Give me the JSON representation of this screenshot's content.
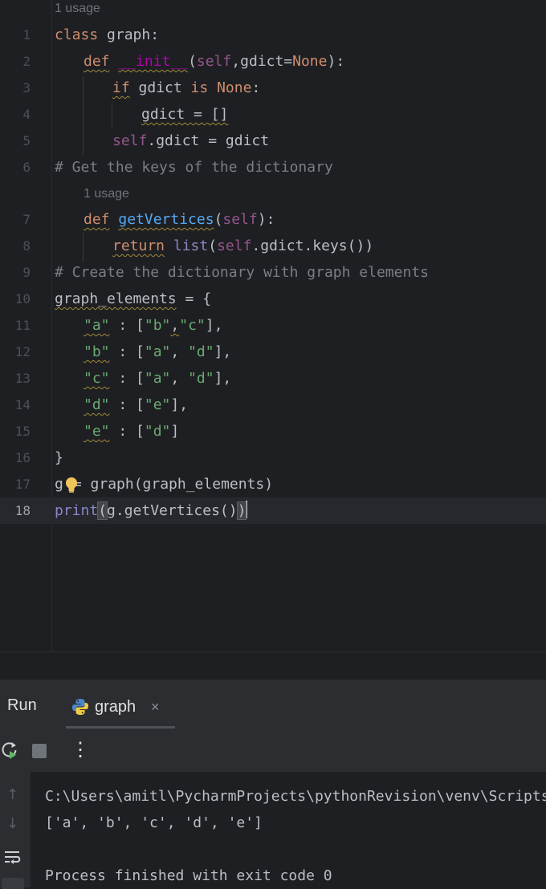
{
  "editor": {
    "usage_hints": [
      "1 usage",
      "1 usage"
    ],
    "line_numbers": [
      "1",
      "2",
      "3",
      "4",
      "5",
      "6",
      "7",
      "8",
      "9",
      "10",
      "11",
      "12",
      "13",
      "14",
      "15",
      "16",
      "17",
      "18"
    ],
    "tokens": {
      "class_kw": "class",
      "class_name": " graph:",
      "def_kw": "def",
      "init_name": "__init__",
      "init_open": "(",
      "self1": "self",
      "init_params": ",gdict=",
      "none1": "None",
      "init_close": "):",
      "if_kw": "if",
      "if_rest": " gdict ",
      "is_kw": "is",
      "none2": "None",
      "if_colon": ":",
      "assign_empty": "gdict = []",
      "self2": "self",
      "assign_attr": ".gdict = gdict",
      "comment1": "# Get the keys of the dictionary",
      "def_kw2": "def",
      "getv_name": "getVertices",
      "getv_open": "(",
      "self3": "self",
      "getv_close": "):",
      "return_kw": "return",
      "list_fn": "list",
      "ret_open": "(",
      "self4": "self",
      "ret_rest": ".gdict.keys())",
      "comment2": "# Create the dictionary with graph elements",
      "ge_name": "graph_elements",
      "ge_rest": " = {",
      "s_a": "\"a\"",
      "s_b": "\"b\"",
      "s_c": "\"c\"",
      "s_d": "\"d\"",
      "s_e": "\"e\"",
      "colon_sp": " : ",
      "open_br": "[",
      "comma": ",",
      "comma_sp": ", ",
      "close_br": "],",
      "close_br_last": "]",
      "close_brace": "}",
      "g_var": "g",
      "g_rest": "= graph(graph_elements)",
      "print_fn": "print",
      "print_open": "(",
      "print_mid": "g.getVertices()",
      "print_close": ")"
    }
  },
  "run_panel": {
    "title": "Run",
    "tab_label": "graph",
    "tab_close": "×",
    "more_label": "⋮",
    "console_lines": [
      "C:\\Users\\amitl\\PycharmProjects\\pythonRevision\\venv\\Scripts\\python.exe",
      "['a', 'b', 'c', 'd', 'e']",
      "",
      "Process finished with exit code 0"
    ]
  },
  "colors": {
    "background": "#1e1f22",
    "panel": "#2b2d30",
    "keyword": "#cf8e6d",
    "function": "#56a8f5",
    "string": "#6aab73",
    "comment": "#7a7e85",
    "self": "#94558d",
    "builtin": "#8888c6",
    "dunder": "#b200b2"
  },
  "icons": [
    "python-icon",
    "rerun-icon",
    "stop-icon",
    "more-icon",
    "lightbulb-icon",
    "arrow-up-icon",
    "arrow-down-icon",
    "soft-wrap-icon",
    "scroll-end-icon",
    "close-icon"
  ]
}
